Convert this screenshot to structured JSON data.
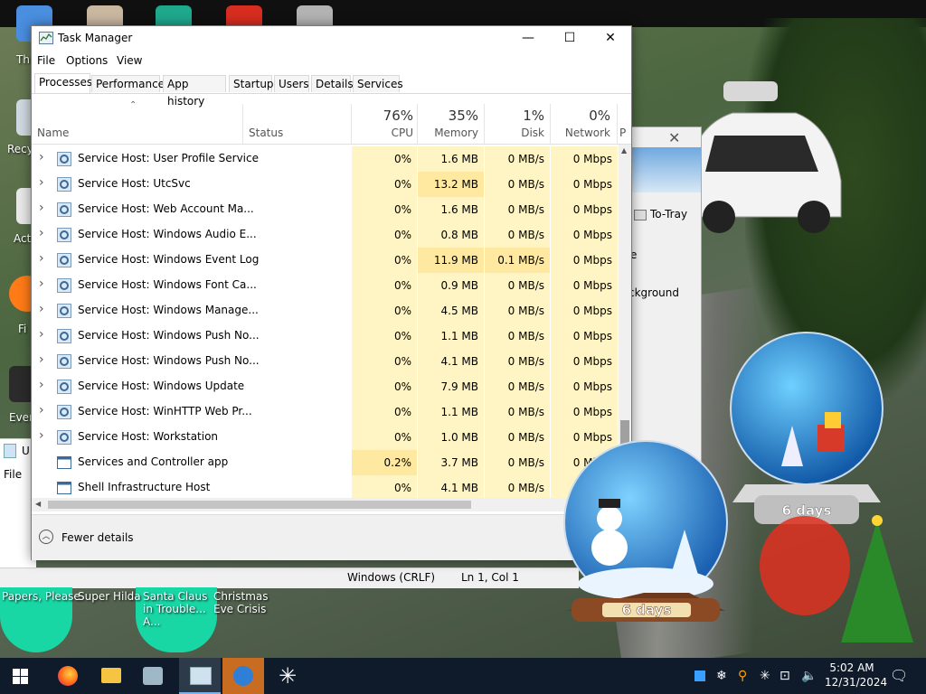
{
  "desktop": {
    "partial_labels": [
      "Th",
      "Recy",
      "Act",
      "Fi",
      "Ever"
    ],
    "games": [
      "Papers, Please",
      "Super Hilda",
      "Santa Claus in Trouble... A...",
      "Christmas Eve Crisis"
    ]
  },
  "background_window": {
    "label_to_tray": "To-Tray",
    "partial_1": "e",
    "partial_2": "ckground",
    "file_menu": "File",
    "left_title_partial": "U",
    "status_encoding": "Windows (CRLF)",
    "status_position": "Ln 1, Col 1"
  },
  "globes": {
    "left_label": "6 days",
    "right_label": "6 days"
  },
  "task_manager": {
    "title": "Task Manager",
    "menu": [
      "File",
      "Options",
      "View"
    ],
    "tabs": [
      "Processes",
      "Performance",
      "App history",
      "Startup",
      "Users",
      "Details",
      "Services"
    ],
    "active_tab": "Processes",
    "columns": {
      "name": "Name",
      "status": "Status",
      "cpu": {
        "pct": "76%",
        "label": "CPU"
      },
      "memory": {
        "pct": "35%",
        "label": "Memory"
      },
      "disk": {
        "pct": "1%",
        "label": "Disk"
      },
      "network": {
        "pct": "0%",
        "label": "Network"
      },
      "extra_partial": "P"
    },
    "rows": [
      {
        "name": "Service Host: User Profile Service",
        "cpu": "0%",
        "mem": "1.6 MB",
        "disk": "0 MB/s",
        "net": "0 Mbps",
        "expand": true
      },
      {
        "name": "Service Host: UtcSvc",
        "cpu": "0%",
        "mem": "13.2 MB",
        "disk": "0 MB/s",
        "net": "0 Mbps",
        "expand": true
      },
      {
        "name": "Service Host: Web Account Ma...",
        "cpu": "0%",
        "mem": "1.6 MB",
        "disk": "0 MB/s",
        "net": "0 Mbps",
        "expand": true
      },
      {
        "name": "Service Host: Windows Audio E...",
        "cpu": "0%",
        "mem": "0.8 MB",
        "disk": "0 MB/s",
        "net": "0 Mbps",
        "expand": true
      },
      {
        "name": "Service Host: Windows Event Log",
        "cpu": "0%",
        "mem": "11.9 MB",
        "disk": "0.1 MB/s",
        "net": "0 Mbps",
        "expand": true
      },
      {
        "name": "Service Host: Windows Font Ca...",
        "cpu": "0%",
        "mem": "0.9 MB",
        "disk": "0 MB/s",
        "net": "0 Mbps",
        "expand": true
      },
      {
        "name": "Service Host: Windows Manage...",
        "cpu": "0%",
        "mem": "4.5 MB",
        "disk": "0 MB/s",
        "net": "0 Mbps",
        "expand": true
      },
      {
        "name": "Service Host: Windows Push No...",
        "cpu": "0%",
        "mem": "1.1 MB",
        "disk": "0 MB/s",
        "net": "0 Mbps",
        "expand": true
      },
      {
        "name": "Service Host: Windows Push No...",
        "cpu": "0%",
        "mem": "4.1 MB",
        "disk": "0 MB/s",
        "net": "0 Mbps",
        "expand": true
      },
      {
        "name": "Service Host: Windows Update",
        "cpu": "0%",
        "mem": "7.9 MB",
        "disk": "0 MB/s",
        "net": "0 Mbps",
        "expand": true
      },
      {
        "name": "Service Host: WinHTTP Web Pr...",
        "cpu": "0%",
        "mem": "1.1 MB",
        "disk": "0 MB/s",
        "net": "0 Mbps",
        "expand": true
      },
      {
        "name": "Service Host: Workstation",
        "cpu": "0%",
        "mem": "1.0 MB",
        "disk": "0 MB/s",
        "net": "0 Mbps",
        "expand": true
      },
      {
        "name": "Services and Controller app",
        "cpu": "0.2%",
        "mem": "3.7 MB",
        "disk": "0 MB/s",
        "net": "0 Mbps",
        "expand": false
      },
      {
        "name": "Shell Infrastructure Host",
        "cpu": "0%",
        "mem": "4.1 MB",
        "disk": "0 MB/s",
        "net": "0 Mbps",
        "expand": false
      }
    ],
    "fewer_details": "Fewer details"
  },
  "taskbar": {
    "clock_time": "5:02 AM",
    "clock_date": "12/31/2024"
  },
  "colors": {
    "cpu_bg": "#fff4c4",
    "cpu_bg_strong": "#ffe9a0",
    "mem_bg": "#fff4c4",
    "mem_bg_strong": "#fcefb0",
    "taskbar": "#0f1b2b",
    "accent": "#0078d7"
  }
}
